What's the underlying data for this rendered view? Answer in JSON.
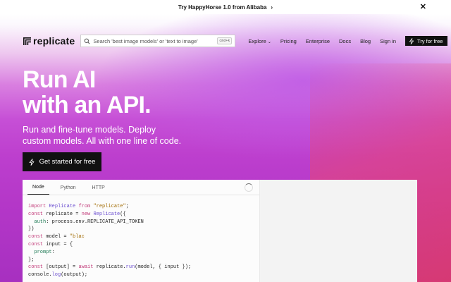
{
  "banner": {
    "text": "Try HappyHorse 1.0 from Alibaba"
  },
  "nav": {
    "logo_text": "replicate",
    "search_placeholder": "Search 'best image models' or 'text to image'",
    "search_shortcut": "cmd+k",
    "links": [
      "Explore",
      "Pricing",
      "Enterprise",
      "Docs",
      "Blog",
      "Sign in"
    ],
    "try_label": "Try for free"
  },
  "hero": {
    "headline_1": "Run AI",
    "headline_2": "with an API.",
    "sub_1": "Run and fine-tune models. Deploy",
    "sub_2": "custom models. All with one line of code.",
    "cta": "Get started for free"
  },
  "code_panel": {
    "tabs": [
      "Node",
      "Python",
      "HTTP"
    ],
    "active_tab": "Node"
  },
  "colors": {
    "accent_dark": "#111111",
    "hero_pink": "#c64fd6",
    "hero_red": "#e64670"
  }
}
